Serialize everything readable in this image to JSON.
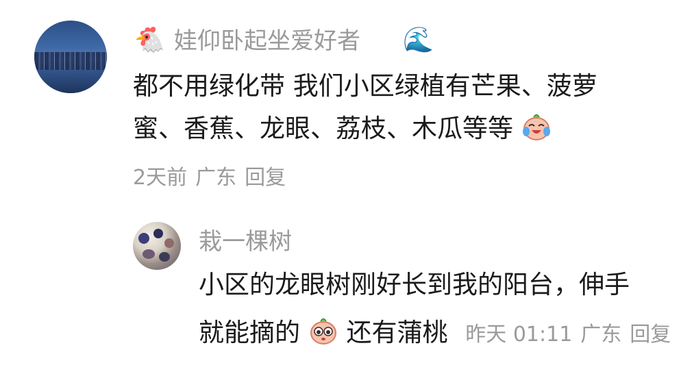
{
  "comment": {
    "username": "娃仰卧起坐爱好者",
    "text_line1": "都不用绿化带 我们小区绿植有芒果、菠萝",
    "text_line2": "蜜、香蕉、龙眼、荔枝、木瓜等等",
    "time": "2天前",
    "location": "广东",
    "reply_label": "回复",
    "emoji_before_name": "🐔",
    "emoji_after_name": "🌊"
  },
  "reply": {
    "username": "栽一棵树",
    "text_line1": "小区的龙眼树刚好长到我的阳台，伸手",
    "text_line2_part1": "就能摘的",
    "text_line2_part2": "还有蒲桃",
    "time": "昨天 01:11",
    "location": "广东",
    "reply_label": "回复"
  }
}
